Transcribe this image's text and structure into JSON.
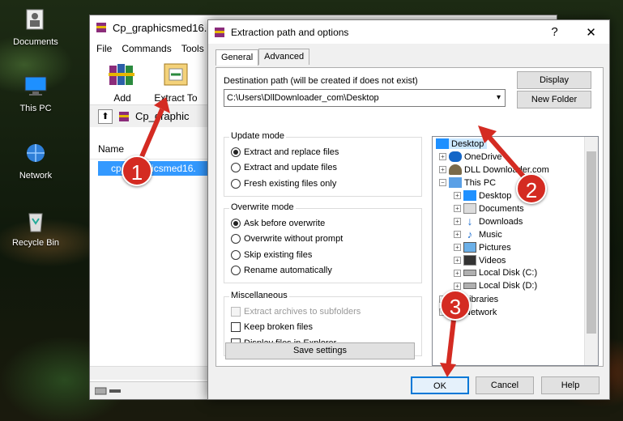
{
  "desktop": {
    "icons": [
      {
        "label": "Documents",
        "icon": "folder-icon"
      },
      {
        "label": "This PC",
        "icon": "computer-icon"
      },
      {
        "label": "Network",
        "icon": "network-icon"
      },
      {
        "label": "Recycle Bin",
        "icon": "recycle-bin-icon"
      }
    ]
  },
  "winrar": {
    "title": "Cp_graphicsmed16.",
    "menu": [
      "File",
      "Commands",
      "Tools"
    ],
    "toolbar": {
      "add": "Add",
      "extract_to": "Extract To"
    },
    "address": "Cp_graphic",
    "list_header": "Name",
    "file": "cp_graphicsmed16."
  },
  "dialog": {
    "title": "Extraction path and options",
    "help_glyph": "?",
    "close_glyph": "✕",
    "tabs": [
      "General",
      "Advanced"
    ],
    "destination_label": "Destination path (will be created if does not exist)",
    "destination_value": "C:\\Users\\DllDownloader_com\\Desktop",
    "display_button": "Display",
    "new_folder_button": "New Folder",
    "update_mode": {
      "title": "Update mode",
      "options": [
        "Extract and replace files",
        "Extract and update files",
        "Fresh existing files only"
      ],
      "selected": 0
    },
    "overwrite_mode": {
      "title": "Overwrite mode",
      "options": [
        "Ask before overwrite",
        "Overwrite without prompt",
        "Skip existing files",
        "Rename automatically"
      ],
      "selected": 0
    },
    "misc": {
      "title": "Miscellaneous",
      "options": [
        "Extract archives to subfolders",
        "Keep broken files",
        "Display files in Explorer"
      ]
    },
    "save_settings": "Save settings",
    "tree": [
      "Desktop",
      "OneDrive",
      "DLL Downloader.com",
      "This PC",
      "Desktop",
      "Documents",
      "Downloads",
      "Music",
      "Pictures",
      "Videos",
      "Local Disk (C:)",
      "Local Disk (D:)",
      "Libraries",
      "Network"
    ],
    "ok": "OK",
    "cancel": "Cancel",
    "help": "Help"
  },
  "markers": [
    "1",
    "2",
    "3"
  ],
  "colors": {
    "selection": "#3399ff",
    "marker": "#d42b22",
    "tree_selected": "#cce8ff"
  }
}
